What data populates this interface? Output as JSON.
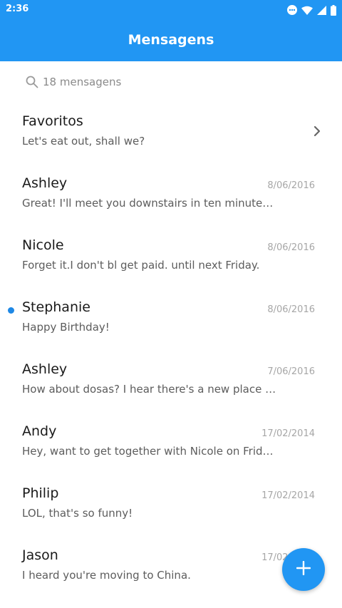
{
  "status_bar": {
    "time": "2:36",
    "icons": [
      "notification-dots-icon",
      "wifi-icon",
      "signal-icon",
      "battery-icon"
    ]
  },
  "app_bar": {
    "title": "Mensagens"
  },
  "search": {
    "label": "18 mensagens",
    "icon": "search-icon"
  },
  "favorites": {
    "name": "Favoritos",
    "preview": "Let's eat out, shall we?",
    "icon": "chevron-right-icon"
  },
  "messages": [
    {
      "name": "Ashley",
      "preview": "Great! I'll meet you downstairs in ten minutes. D...",
      "date": "8/06/2016",
      "unread": false
    },
    {
      "name": "Nicole",
      "preview": "Forget it.I don't bl get paid. until next Friday.",
      "date": "8/06/2016",
      "unread": false
    },
    {
      "name": "Stephanie",
      "preview": "Happy Birthday!",
      "date": "8/06/2016",
      "unread": true
    },
    {
      "name": "Ashley",
      "preview": "How about dosas? I hear there's a new place do...",
      "date": "7/06/2016",
      "unread": false
    },
    {
      "name": "Andy",
      "preview": "Hey, want to get together with Nicole on Friday?",
      "date": "17/02/2014",
      "unread": false
    },
    {
      "name": "Philip",
      "preview": "LOL, that's so funny!",
      "date": "17/02/2014",
      "unread": false
    },
    {
      "name": "Jason",
      "preview": "I heard you're moving to China.",
      "date": "17/02/2014",
      "unread": false
    }
  ],
  "fab": {
    "icon": "plus-icon"
  },
  "colors": {
    "primary": "#2196f3",
    "unread_dot": "#1e88e5",
    "name_text": "#1a1a1a",
    "preview_text": "#5c5c5c",
    "date_text": "#a6a6a6"
  }
}
